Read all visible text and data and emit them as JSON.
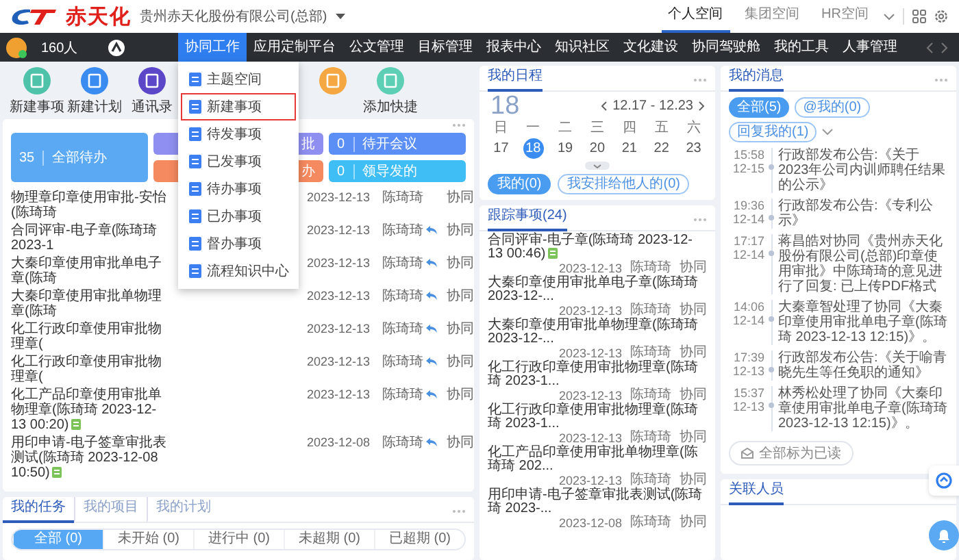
{
  "header": {
    "brand": "赤天化",
    "company": "贵州赤天化股份有限公司(总部)",
    "spaces": [
      {
        "label": "个人空间",
        "selected": true
      },
      {
        "label": "集团空间",
        "selected": false
      },
      {
        "label": "HR空间",
        "selected": false
      }
    ]
  },
  "nav": {
    "online_count": "160人",
    "items": [
      {
        "label": "协同工作",
        "selected": true
      },
      {
        "label": "应用定制平台",
        "selected": false
      },
      {
        "label": "公文管理",
        "selected": false
      },
      {
        "label": "目标管理",
        "selected": false
      },
      {
        "label": "报表中心",
        "selected": false
      },
      {
        "label": "知识社区",
        "selected": false
      },
      {
        "label": "文化建设",
        "selected": false
      },
      {
        "label": "协同驾驶舱",
        "selected": false
      },
      {
        "label": "我的工具",
        "selected": false
      },
      {
        "label": "人事管理",
        "selected": false
      }
    ]
  },
  "menu": {
    "items": [
      {
        "label": "主题空间",
        "highlighted": false
      },
      {
        "label": "新建事项",
        "highlighted": true
      },
      {
        "label": "待发事项",
        "highlighted": false
      },
      {
        "label": "已发事项",
        "highlighted": false
      },
      {
        "label": "待办事项",
        "highlighted": false
      },
      {
        "label": "已办事项",
        "highlighted": false
      },
      {
        "label": "督办事项",
        "highlighted": false
      },
      {
        "label": "流程知识中心",
        "highlighted": false
      }
    ]
  },
  "shortcuts": [
    {
      "label": "新建事项",
      "color": "#4fc3a9"
    },
    {
      "label": "新建计划",
      "color": "#3b8cf0"
    },
    {
      "label": "通讯录",
      "color": "#5b47c8"
    },
    {
      "color": "#f5a742"
    },
    {
      "label": "添加快捷",
      "color": "#5ccfb5"
    }
  ],
  "todo": {
    "tiles": [
      {
        "kind": "main",
        "count": "35",
        "label": "全部待办",
        "color": "#5aa9f2"
      },
      {
        "kind": "small",
        "label": "批",
        "color": "#8e8ff0"
      },
      {
        "kind": "small",
        "label": "办",
        "color": "#f5895f"
      },
      {
        "kind": "small",
        "count": "0",
        "label": "待开会议",
        "color": "#5b8ff6"
      },
      {
        "kind": "small",
        "count": "0",
        "label": "领导发的",
        "color": "#3fbdf5"
      }
    ],
    "rows": [
      {
        "title": "物理章印章使用审批-安怡(陈琦琦",
        "date": "2023-12-13",
        "person": "陈琦琦",
        "replied": false,
        "attached": false,
        "type": "协同"
      },
      {
        "title": "合同评审-电子章(陈琦琦 2023-1",
        "date": "2023-12-13",
        "person": "陈琦琦",
        "replied": true,
        "attached": false,
        "type": "协同"
      },
      {
        "title": "大秦印章使用审批单电子章(陈琦",
        "date": "2023-12-13",
        "person": "陈琦琦",
        "replied": true,
        "attached": false,
        "type": "协同"
      },
      {
        "title": "大秦印章使用审批单物理章(陈琦",
        "date": "2023-12-13",
        "person": "陈琦琦",
        "replied": true,
        "attached": false,
        "type": "协同"
      },
      {
        "title": "化工行政印章使用审批物理章(",
        "date": "2023-12-13",
        "person": "陈琦琦",
        "replied": true,
        "attached": false,
        "type": "协同"
      },
      {
        "title": "化工行政印章使用审批物理章(",
        "date": "2023-12-13",
        "person": "陈琦琦",
        "replied": true,
        "attached": false,
        "type": "协同"
      },
      {
        "title": "化工产品印章使用审批单物理章(陈琦琦 2023-12-13 00:20)",
        "date": "2023-12-13",
        "person": "陈琦琦",
        "replied": true,
        "attached": true,
        "type": "协同"
      },
      {
        "title": "用印申请-电子签章审批表测试(陈琦琦 2023-12-08 10:50)",
        "date": "2023-12-08",
        "person": "陈琦琦",
        "replied": true,
        "attached": true,
        "type": "协同"
      }
    ]
  },
  "tasks": {
    "tabs": [
      {
        "label": "我的任务",
        "selected": true
      },
      {
        "label": "我的项目",
        "selected": false
      },
      {
        "label": "我的计划",
        "selected": false
      }
    ],
    "filters": [
      {
        "label": "全部 (0)",
        "selected": true
      },
      {
        "label": "未开始 (0)",
        "selected": false
      },
      {
        "label": "进行中 (0)",
        "selected": false
      },
      {
        "label": "未超期 (0)",
        "selected": false
      },
      {
        "label": "已超期 (0)",
        "selected": false
      }
    ]
  },
  "schedule": {
    "title": "我的日程",
    "day": "18",
    "range": "12.17 - 12.23",
    "weekdays": [
      "日",
      "一",
      "二",
      "三",
      "四",
      "五",
      "六"
    ],
    "dates": [
      {
        "label": "17",
        "selected": false
      },
      {
        "label": "18",
        "selected": true
      },
      {
        "label": "19",
        "selected": false
      },
      {
        "label": "20",
        "selected": false
      },
      {
        "label": "21",
        "selected": false
      },
      {
        "label": "22",
        "selected": false
      },
      {
        "label": "23",
        "selected": false
      }
    ],
    "filters": [
      {
        "label": "我的(0)",
        "selected": true
      },
      {
        "label": "我安排给他人的(0)",
        "selected": false
      }
    ]
  },
  "tracking": {
    "title": "跟踪事项(24)",
    "rows": [
      {
        "title": "合同评审-电子章(陈琦琦 2023-12-13 00:46)",
        "attached": true,
        "date": "2023-12-13",
        "person": "陈琦琦",
        "type": "协同"
      },
      {
        "title": "大秦印章使用审批单电子章(陈琦琦 2023-12-...",
        "attached": false,
        "date": "2023-12-13",
        "person": "陈琦琦",
        "type": "协同"
      },
      {
        "title": "大秦印章使用审批单物理章(陈琦琦 2023-12-...",
        "attached": false,
        "date": "2023-12-13",
        "person": "陈琦琦",
        "type": "协同"
      },
      {
        "title": "化工行政印章使用审批物理章(陈琦琦 2023-1...",
        "attached": false,
        "date": "2023-12-13",
        "person": "陈琦琦",
        "type": "协同"
      },
      {
        "title": "化工行政印章使用审批物理章(陈琦琦 2023-1...",
        "attached": false,
        "date": "2023-12-13",
        "person": "陈琦琦",
        "type": "协同"
      },
      {
        "title": "化工产品印章使用审批单物理章(陈琦琦 202...",
        "attached": false,
        "date": "2023-12-13",
        "person": "陈琦琦",
        "type": "协同"
      },
      {
        "title": "用印申请-电子签章审批表测试(陈琦琦 2023-...",
        "attached": false,
        "date": "2023-12-08",
        "person": "陈琦琦",
        "type": "协同"
      }
    ]
  },
  "messages": {
    "title": "我的消息",
    "filters": [
      {
        "label": "全部(5)",
        "selected": true
      },
      {
        "label": "@我的(0)",
        "selected": false
      },
      {
        "label": "回复我的(1)",
        "selected": false
      }
    ],
    "items": [
      {
        "time": "15:58",
        "date": "12-15",
        "text": "行政部发布公告:《关于2023年公司内训师聘任结果的公示》"
      },
      {
        "time": "19:36",
        "date": "12-14",
        "text": "行政部发布公告:《专利公示》"
      },
      {
        "time": "17:17",
        "date": "12-14",
        "text": "蒋昌皓对协同《贵州赤天化股份有限公司(总部)印章使用审批》中陈琦琦的意见进行了回复: 已上传PDF格式"
      },
      {
        "time": "14:06",
        "date": "12-14",
        "text": "大秦章智处理了协同《大秦印章使用审批单电子章(陈琦琦 2023-12-13 12:15)》。"
      },
      {
        "time": "17:39",
        "date": "12-13",
        "text": "行政部发布公告:《关于喻青晓先生等任免职的通知》"
      },
      {
        "time": "15:37",
        "date": "12-13",
        "text": "林秀松处理了协同《大秦印章使用审批单电子章(陈琦琦 2023-12-13 12:15)》。"
      }
    ],
    "mark_all": "全部标为已读"
  },
  "related": {
    "title": "关联人员"
  }
}
